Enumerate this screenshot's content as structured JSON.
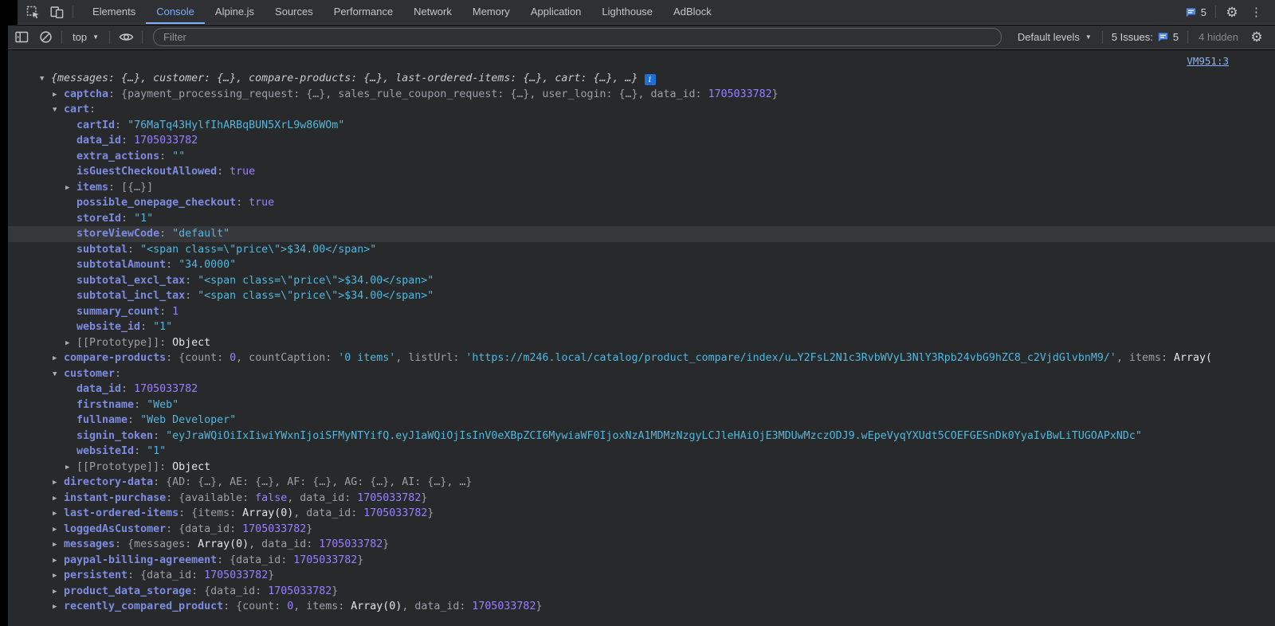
{
  "devtools": {
    "tabbar": {
      "tabs": [
        {
          "label": "Elements",
          "active": false
        },
        {
          "label": "Console",
          "active": true
        },
        {
          "label": "Alpine.js",
          "active": false
        },
        {
          "label": "Sources",
          "active": false
        },
        {
          "label": "Performance",
          "active": false
        },
        {
          "label": "Network",
          "active": false
        },
        {
          "label": "Memory",
          "active": false
        },
        {
          "label": "Application",
          "active": false
        },
        {
          "label": "Lighthouse",
          "active": false
        },
        {
          "label": "AdBlock",
          "active": false
        }
      ],
      "issues_count": "5"
    },
    "toolbar": {
      "context": "top",
      "filter_placeholder": "Filter",
      "levels_label": "Default levels",
      "issues_label": "5 Issues:",
      "issues_count": "5",
      "hidden_label": "4 hidden"
    },
    "console": {
      "source_link": "VM951:3",
      "rows": [
        {
          "level": 0,
          "arrow": "down",
          "segs": [
            [
              "i",
              "{messages: {…}, customer: {…}, compare-products: {…}, last-ordered-items: {…}, cart: {…}, …}"
            ],
            [
              "info",
              "i"
            ]
          ]
        },
        {
          "level": 1,
          "arrow": "right",
          "segs": [
            [
              "k",
              "captcha"
            ],
            [
              "d",
              ": {payment_processing_request: {…}, sales_rule_coupon_request: {…}, user_login: {…}, data_id: "
            ],
            [
              "n",
              "1705033782"
            ],
            [
              "d",
              "}"
            ]
          ]
        },
        {
          "level": 1,
          "arrow": "down",
          "segs": [
            [
              "k",
              "cart"
            ],
            [
              "d",
              ":"
            ]
          ]
        },
        {
          "level": 2,
          "arrow": null,
          "segs": [
            [
              "k",
              "cartId"
            ],
            [
              "d",
              ": "
            ],
            [
              "s",
              "\"76MaTq43HylfIhARBqBUN5XrL9w86WOm\""
            ]
          ]
        },
        {
          "level": 2,
          "arrow": null,
          "segs": [
            [
              "k",
              "data_id"
            ],
            [
              "d",
              ": "
            ],
            [
              "n",
              "1705033782"
            ]
          ]
        },
        {
          "level": 2,
          "arrow": null,
          "segs": [
            [
              "k",
              "extra_actions"
            ],
            [
              "d",
              ": "
            ],
            [
              "s",
              "\"\""
            ]
          ]
        },
        {
          "level": 2,
          "arrow": null,
          "segs": [
            [
              "k",
              "isGuestCheckoutAllowed"
            ],
            [
              "d",
              ": "
            ],
            [
              "n",
              "true"
            ]
          ]
        },
        {
          "level": 2,
          "arrow": "right",
          "segs": [
            [
              "k",
              "items"
            ],
            [
              "d",
              ": [{…}]"
            ]
          ]
        },
        {
          "level": 2,
          "arrow": null,
          "segs": [
            [
              "k",
              "possible_onepage_checkout"
            ],
            [
              "d",
              ": "
            ],
            [
              "n",
              "true"
            ]
          ]
        },
        {
          "level": 2,
          "arrow": null,
          "segs": [
            [
              "k",
              "storeId"
            ],
            [
              "d",
              ": "
            ],
            [
              "s",
              "\"1\""
            ]
          ]
        },
        {
          "level": 2,
          "arrow": null,
          "highlight": true,
          "segs": [
            [
              "k",
              "storeViewCode"
            ],
            [
              "d",
              ": "
            ],
            [
              "s",
              "\"default\""
            ]
          ]
        },
        {
          "level": 2,
          "arrow": null,
          "segs": [
            [
              "k",
              "subtotal"
            ],
            [
              "d",
              ": "
            ],
            [
              "s",
              "\"<span class=\\\"price\\\">$34.00</span>\""
            ]
          ]
        },
        {
          "level": 2,
          "arrow": null,
          "segs": [
            [
              "k",
              "subtotalAmount"
            ],
            [
              "d",
              ": "
            ],
            [
              "s",
              "\"34.0000\""
            ]
          ]
        },
        {
          "level": 2,
          "arrow": null,
          "segs": [
            [
              "k",
              "subtotal_excl_tax"
            ],
            [
              "d",
              ": "
            ],
            [
              "s",
              "\"<span class=\\\"price\\\">$34.00</span>\""
            ]
          ]
        },
        {
          "level": 2,
          "arrow": null,
          "segs": [
            [
              "k",
              "subtotal_incl_tax"
            ],
            [
              "d",
              ": "
            ],
            [
              "s",
              "\"<span class=\\\"price\\\">$34.00</span>\""
            ]
          ]
        },
        {
          "level": 2,
          "arrow": null,
          "segs": [
            [
              "k",
              "summary_count"
            ],
            [
              "d",
              ": "
            ],
            [
              "n",
              "1"
            ]
          ]
        },
        {
          "level": 2,
          "arrow": null,
          "segs": [
            [
              "k",
              "website_id"
            ],
            [
              "d",
              ": "
            ],
            [
              "s",
              "\"1\""
            ]
          ]
        },
        {
          "level": 2,
          "arrow": "right",
          "segs": [
            [
              "d",
              "[[Prototype]]"
            ],
            [
              "d",
              ": "
            ],
            [
              "w",
              "Object"
            ]
          ]
        },
        {
          "level": 1,
          "arrow": "right",
          "segs": [
            [
              "k",
              "compare-products"
            ],
            [
              "d",
              ": {count: "
            ],
            [
              "n",
              "0"
            ],
            [
              "d",
              ", countCaption: "
            ],
            [
              "s",
              "'0 items'"
            ],
            [
              "d",
              ", listUrl: "
            ],
            [
              "s",
              "'https://m246.local/catalog/product_compare/index/u…Y2FsL2N1c3RvbWVyL3NlY3Rpb24vbG9hZC8_c2VjdGlvbnM9/'"
            ],
            [
              "d",
              ", items: "
            ],
            [
              "w",
              "Array("
            ]
          ]
        },
        {
          "level": 1,
          "arrow": "down",
          "segs": [
            [
              "k",
              "customer"
            ],
            [
              "d",
              ":"
            ]
          ]
        },
        {
          "level": 2,
          "arrow": null,
          "segs": [
            [
              "k",
              "data_id"
            ],
            [
              "d",
              ": "
            ],
            [
              "n",
              "1705033782"
            ]
          ]
        },
        {
          "level": 2,
          "arrow": null,
          "segs": [
            [
              "k",
              "firstname"
            ],
            [
              "d",
              ": "
            ],
            [
              "s",
              "\"Web\""
            ]
          ]
        },
        {
          "level": 2,
          "arrow": null,
          "segs": [
            [
              "k",
              "fullname"
            ],
            [
              "d",
              ": "
            ],
            [
              "s",
              "\"Web Developer\""
            ]
          ]
        },
        {
          "level": 2,
          "arrow": null,
          "segs": [
            [
              "k",
              "signin_token"
            ],
            [
              "d",
              ": "
            ],
            [
              "s",
              "\"eyJraWQiOiIxIiwiYWxnIjoiSFMyNTYifQ.eyJ1aWQiOjIsInV0eXBpZCI6MywiaWF0IjoxNzA1MDMzNzgyLCJleHAiOjE3MDUwMzczODJ9.wEpeVyqYXUdt5COEFGESnDk0YyaIvBwLiTUGOAPxNDc\""
            ]
          ]
        },
        {
          "level": 2,
          "arrow": null,
          "segs": [
            [
              "k",
              "websiteId"
            ],
            [
              "d",
              ": "
            ],
            [
              "s",
              "\"1\""
            ]
          ]
        },
        {
          "level": 2,
          "arrow": "right",
          "segs": [
            [
              "d",
              "[[Prototype]]"
            ],
            [
              "d",
              ": "
            ],
            [
              "w",
              "Object"
            ]
          ]
        },
        {
          "level": 1,
          "arrow": "right",
          "segs": [
            [
              "k",
              "directory-data"
            ],
            [
              "d",
              ": {AD: {…}, AE: {…}, AF: {…}, AG: {…}, AI: {…}, …}"
            ]
          ]
        },
        {
          "level": 1,
          "arrow": "right",
          "segs": [
            [
              "k",
              "instant-purchase"
            ],
            [
              "d",
              ": {available: "
            ],
            [
              "n",
              "false"
            ],
            [
              "d",
              ", data_id: "
            ],
            [
              "n",
              "1705033782"
            ],
            [
              "d",
              "}"
            ]
          ]
        },
        {
          "level": 1,
          "arrow": "right",
          "segs": [
            [
              "k",
              "last-ordered-items"
            ],
            [
              "d",
              ": {items: "
            ],
            [
              "w",
              "Array(0)"
            ],
            [
              "d",
              ", data_id: "
            ],
            [
              "n",
              "1705033782"
            ],
            [
              "d",
              "}"
            ]
          ]
        },
        {
          "level": 1,
          "arrow": "right",
          "segs": [
            [
              "k",
              "loggedAsCustomer"
            ],
            [
              "d",
              ": {data_id: "
            ],
            [
              "n",
              "1705033782"
            ],
            [
              "d",
              "}"
            ]
          ]
        },
        {
          "level": 1,
          "arrow": "right",
          "segs": [
            [
              "k",
              "messages"
            ],
            [
              "d",
              ": {messages: "
            ],
            [
              "w",
              "Array(0)"
            ],
            [
              "d",
              ", data_id: "
            ],
            [
              "n",
              "1705033782"
            ],
            [
              "d",
              "}"
            ]
          ]
        },
        {
          "level": 1,
          "arrow": "right",
          "segs": [
            [
              "k",
              "paypal-billing-agreement"
            ],
            [
              "d",
              ": {data_id: "
            ],
            [
              "n",
              "1705033782"
            ],
            [
              "d",
              "}"
            ]
          ]
        },
        {
          "level": 1,
          "arrow": "right",
          "segs": [
            [
              "k",
              "persistent"
            ],
            [
              "d",
              ": {data_id: "
            ],
            [
              "n",
              "1705033782"
            ],
            [
              "d",
              "}"
            ]
          ]
        },
        {
          "level": 1,
          "arrow": "right",
          "segs": [
            [
              "k",
              "product_data_storage"
            ],
            [
              "d",
              ": {data_id: "
            ],
            [
              "n",
              "1705033782"
            ],
            [
              "d",
              "}"
            ]
          ]
        },
        {
          "level": 1,
          "arrow": "right",
          "segs": [
            [
              "k",
              "recently_compared_product"
            ],
            [
              "d",
              ": {count: "
            ],
            [
              "n",
              "0"
            ],
            [
              "d",
              ", items: "
            ],
            [
              "w",
              "Array(0)"
            ],
            [
              "d",
              ", data_id: "
            ],
            [
              "n",
              "1705033782"
            ],
            [
              "d",
              "}"
            ]
          ]
        }
      ]
    },
    "colors": {
      "accent_blue": "#7cacf8",
      "link_blue": "#8ab4f8",
      "key_purple": "#7d8be0",
      "string_cyan": "#53b6dc",
      "number_violet": "#9980ff",
      "info_badge_blue": "#1f6fd4",
      "issues_bubble_blue": "#4e8bec",
      "panel_bg": "#28292b",
      "toolbar_bg": "#2f3033"
    }
  }
}
